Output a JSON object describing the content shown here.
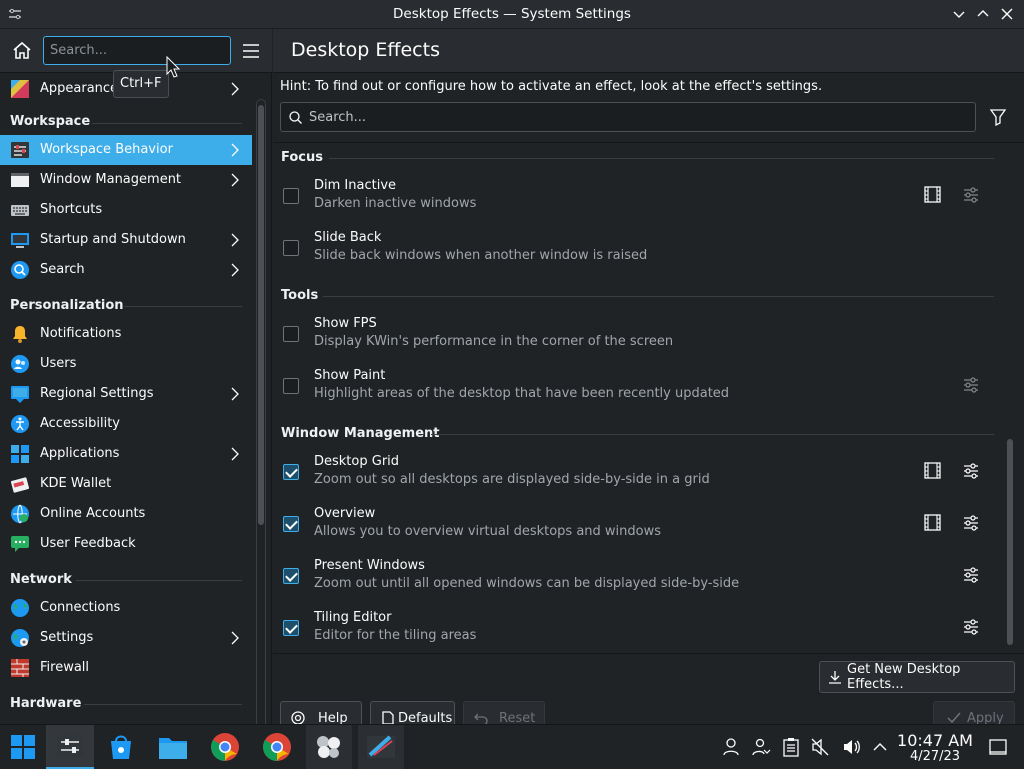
{
  "window": {
    "title": "Desktop Effects — System Settings"
  },
  "sidebar": {
    "search_placeholder": "Search...",
    "tooltip": "Ctrl+F",
    "items": [
      {
        "label": "Appearance",
        "icon": "appearance-icon",
        "chevron": true
      },
      {
        "section": "Workspace"
      },
      {
        "label": "Workspace Behavior",
        "icon": "workspace-behavior-icon",
        "chevron": true,
        "selected": true
      },
      {
        "label": "Window Management",
        "icon": "window-management-icon",
        "chevron": true
      },
      {
        "label": "Shortcuts",
        "icon": "keyboard-icon",
        "chevron": false
      },
      {
        "label": "Startup and Shutdown",
        "icon": "startup-icon",
        "chevron": true
      },
      {
        "label": "Search",
        "icon": "search-icon",
        "chevron": true
      },
      {
        "section": "Personalization"
      },
      {
        "label": "Notifications",
        "icon": "bell-icon",
        "chevron": false
      },
      {
        "label": "Users",
        "icon": "users-icon",
        "chevron": false
      },
      {
        "label": "Regional Settings",
        "icon": "regional-icon",
        "chevron": true
      },
      {
        "label": "Accessibility",
        "icon": "accessibility-icon",
        "chevron": false
      },
      {
        "label": "Applications",
        "icon": "applications-icon",
        "chevron": true
      },
      {
        "label": "KDE Wallet",
        "icon": "wallet-icon",
        "chevron": false
      },
      {
        "label": "Online Accounts",
        "icon": "online-accounts-icon",
        "chevron": false
      },
      {
        "label": "User Feedback",
        "icon": "feedback-icon",
        "chevron": false
      },
      {
        "section": "Network"
      },
      {
        "label": "Connections",
        "icon": "globe-icon",
        "chevron": false
      },
      {
        "label": "Settings",
        "icon": "network-settings-icon",
        "chevron": true
      },
      {
        "label": "Firewall",
        "icon": "firewall-icon",
        "chevron": false
      },
      {
        "section": "Hardware"
      }
    ]
  },
  "main": {
    "heading": "Desktop Effects",
    "hint": "Hint: To find out or configure how to activate an effect, look at the effect's settings.",
    "search_placeholder": "Search...",
    "groups": [
      {
        "name": "Focus",
        "effects": [
          {
            "title": "Dim Inactive",
            "desc": "Darken inactive windows",
            "checked": false,
            "video": true,
            "configure": true
          },
          {
            "title": "Slide Back",
            "desc": "Slide back windows when another window is raised",
            "checked": false,
            "video": false,
            "configure": false
          }
        ]
      },
      {
        "name": "Tools",
        "effects": [
          {
            "title": "Show FPS",
            "desc": "Display KWin's performance in the corner of the screen",
            "checked": false,
            "video": false,
            "configure": false
          },
          {
            "title": "Show Paint",
            "desc": "Highlight areas of the desktop that have been recently updated",
            "checked": false,
            "video": false,
            "configure": true
          }
        ]
      },
      {
        "name": "Window Management",
        "effects": [
          {
            "title": "Desktop Grid",
            "desc": "Zoom out so all desktops are displayed side-by-side in a grid",
            "checked": true,
            "video": true,
            "configure": true
          },
          {
            "title": "Overview",
            "desc": "Allows you to overview virtual desktops and windows",
            "checked": true,
            "video": true,
            "configure": true
          },
          {
            "title": "Present Windows",
            "desc": "Zoom out until all opened windows can be displayed side-by-side",
            "checked": true,
            "video": false,
            "configure": true
          },
          {
            "title": "Tiling Editor",
            "desc": "Editor for the tiling areas",
            "checked": true,
            "video": false,
            "configure": true
          }
        ]
      }
    ],
    "get_new_label": "Get New Desktop Effects...",
    "help_label": "Help",
    "defaults_label": "Defaults",
    "reset_label": "Reset",
    "apply_label": "Apply"
  },
  "taskbar": {
    "apps": [
      "app-launcher-icon",
      "system-settings-icon",
      "discover-icon",
      "file-manager-icon",
      "chrome-icon",
      "chrome-icon",
      "steam-like-icon",
      "krita-like-icon"
    ],
    "time": "10:47 AM",
    "date": "4/27/23"
  },
  "colors": {
    "accent": "#3daee9",
    "background": "#202326",
    "header": "#292c30"
  }
}
